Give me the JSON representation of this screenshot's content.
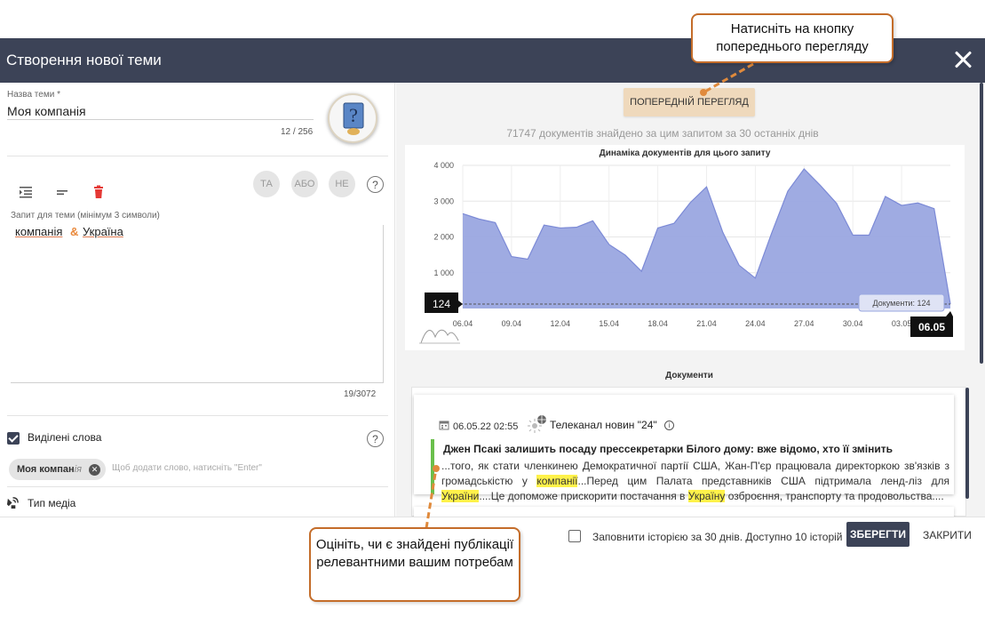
{
  "header": {
    "title": "Створення нової теми"
  },
  "topic_name": {
    "label": "Назва теми",
    "required_mark": "*",
    "value": "Моя компанія",
    "counter": "12 / 256"
  },
  "operators": [
    {
      "label": "ТА"
    },
    {
      "label": "АБО"
    },
    {
      "label": "НЕ"
    }
  ],
  "query": {
    "label": "Запит для теми (мінімум 3 символи)",
    "tokens": [
      {
        "word": "компанія"
      },
      {
        "op": "&"
      },
      {
        "word": "Україна"
      }
    ],
    "counter": "19/3072"
  },
  "highlighted_words": {
    "label": "Виділені слова",
    "checked": true,
    "chip": {
      "bold": "Моя компан",
      "rest": "ія"
    },
    "input_placeholder": "Щоб додати слово, натисніть \"Enter\""
  },
  "media_type": {
    "label": "Тип медіа"
  },
  "preview": {
    "button_label": "ПОПЕРЕДНІЙ ПЕРЕГЛЯД",
    "found_text": "71747 документів знайдено за цим запитом за 30 останніх днів"
  },
  "chart_data": {
    "type": "area",
    "title": "Динаміка документів для цього запиту",
    "x": [
      "06.04",
      "07.04",
      "08.04",
      "09.04",
      "10.04",
      "11.04",
      "12.04",
      "13.04",
      "14.04",
      "15.04",
      "16.04",
      "17.04",
      "18.04",
      "19.04",
      "20.04",
      "21.04",
      "22.04",
      "23.04",
      "24.04",
      "25.04",
      "26.04",
      "27.04",
      "28.04",
      "29.04",
      "30.04",
      "01.05",
      "02.05",
      "03.05",
      "04.05",
      "05.05",
      "06.05"
    ],
    "values": [
      2650,
      2500,
      2400,
      1450,
      1380,
      2330,
      2250,
      2270,
      2450,
      1790,
      1490,
      1040,
      2250,
      2380,
      2960,
      3400,
      2130,
      1210,
      850,
      2100,
      3280,
      3900,
      3440,
      2940,
      2050,
      2050,
      3130,
      2880,
      2950,
      2790,
      124
    ],
    "xticks": [
      "06.04",
      "09.04",
      "12.04",
      "15.04",
      "18.04",
      "21.04",
      "24.04",
      "27.04",
      "30.04",
      "03.05"
    ],
    "yticks": [
      "4 000",
      "3 000",
      "2 000",
      "1 000"
    ],
    "ylim": [
      0,
      4000
    ],
    "fill_color": "#9aa7e0",
    "line_color": "#7c8ad6",
    "reference_value": "124",
    "selected_date": "06.05",
    "tooltip": "Документи: 124"
  },
  "documents": {
    "heading": "Документи",
    "items": [
      {
        "date": "06.05.22 02:55",
        "source": "Телеканал новин \"24\"",
        "title": "Джен Псакі залишить посаду прессекретарки Білого дому: вже відомо, хто її змінить",
        "snippet_parts": [
          {
            "t": "...того, як стати членкинею Демократичної партії США, Жан-П'єр працювала директоркою зв'язків з громадськістю у "
          },
          {
            "t": "компанії",
            "hl": true
          },
          {
            "t": "...Перед цим Палата представників США підтримала ленд-ліз для "
          },
          {
            "t": "України",
            "hl": true
          },
          {
            "t": "....Це допоможе прискорити постачання в "
          },
          {
            "t": "Україну",
            "hl": true
          },
          {
            "t": " озброєння, транспорту та продовольства...."
          }
        ]
      }
    ]
  },
  "footer": {
    "fill_history_label": "Заповнити історією за 30 днів. Доступно 10 історій",
    "save_label": "ЗБЕРЕГТИ",
    "close_label": "ЗАКРИТИ"
  },
  "callouts": {
    "top": "Натисніть на кнопку попереднього перегляду",
    "bottom": "Оцініть, чи є знайдені публікації релевантними вашим потребам"
  },
  "colors": {
    "header_bg": "#3c4357",
    "preview_button": "#efd9bc",
    "callout_border": "#c46d2a",
    "highlight": "#fff24a"
  }
}
